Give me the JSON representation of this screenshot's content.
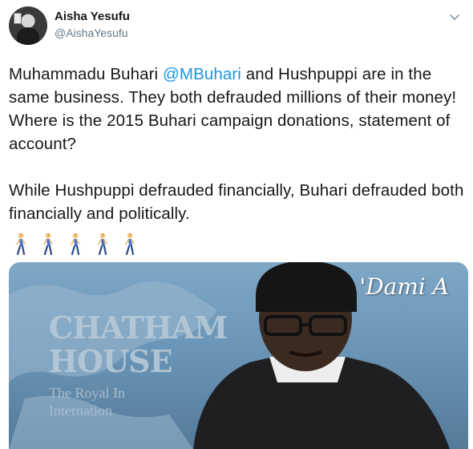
{
  "author": {
    "display_name": "Aisha Yesufu",
    "handle": "@AishaYesufu",
    "avatar_icon": "profile-photo",
    "menu_icon": "chevron-down-icon"
  },
  "tweet": {
    "p1_part1": "Muhammadu Buhari ",
    "mention": "@MBuhari",
    "p1_part2": " and Hushpuppi are in the same business. They both  defrauded millions of their money! Where is the 2015 Buhari campaign donations, statement of account?",
    "p2": "While Hushpuppi defrauded financially, Buhari defrauded both financially and politically.",
    "emoji": [
      "person-walking",
      "person-walking",
      "person-walking",
      "person-walking",
      "person-walking"
    ]
  },
  "media": {
    "watermark": "'Dami A",
    "backdrop_title": "CHATHAM",
    "backdrop_title2": "HOUSE",
    "backdrop_sub1": "The Royal In",
    "backdrop_sub2": "Internation"
  },
  "colors": {
    "link": "#1b95e0",
    "text": "#14171a",
    "secondary": "#657786"
  }
}
